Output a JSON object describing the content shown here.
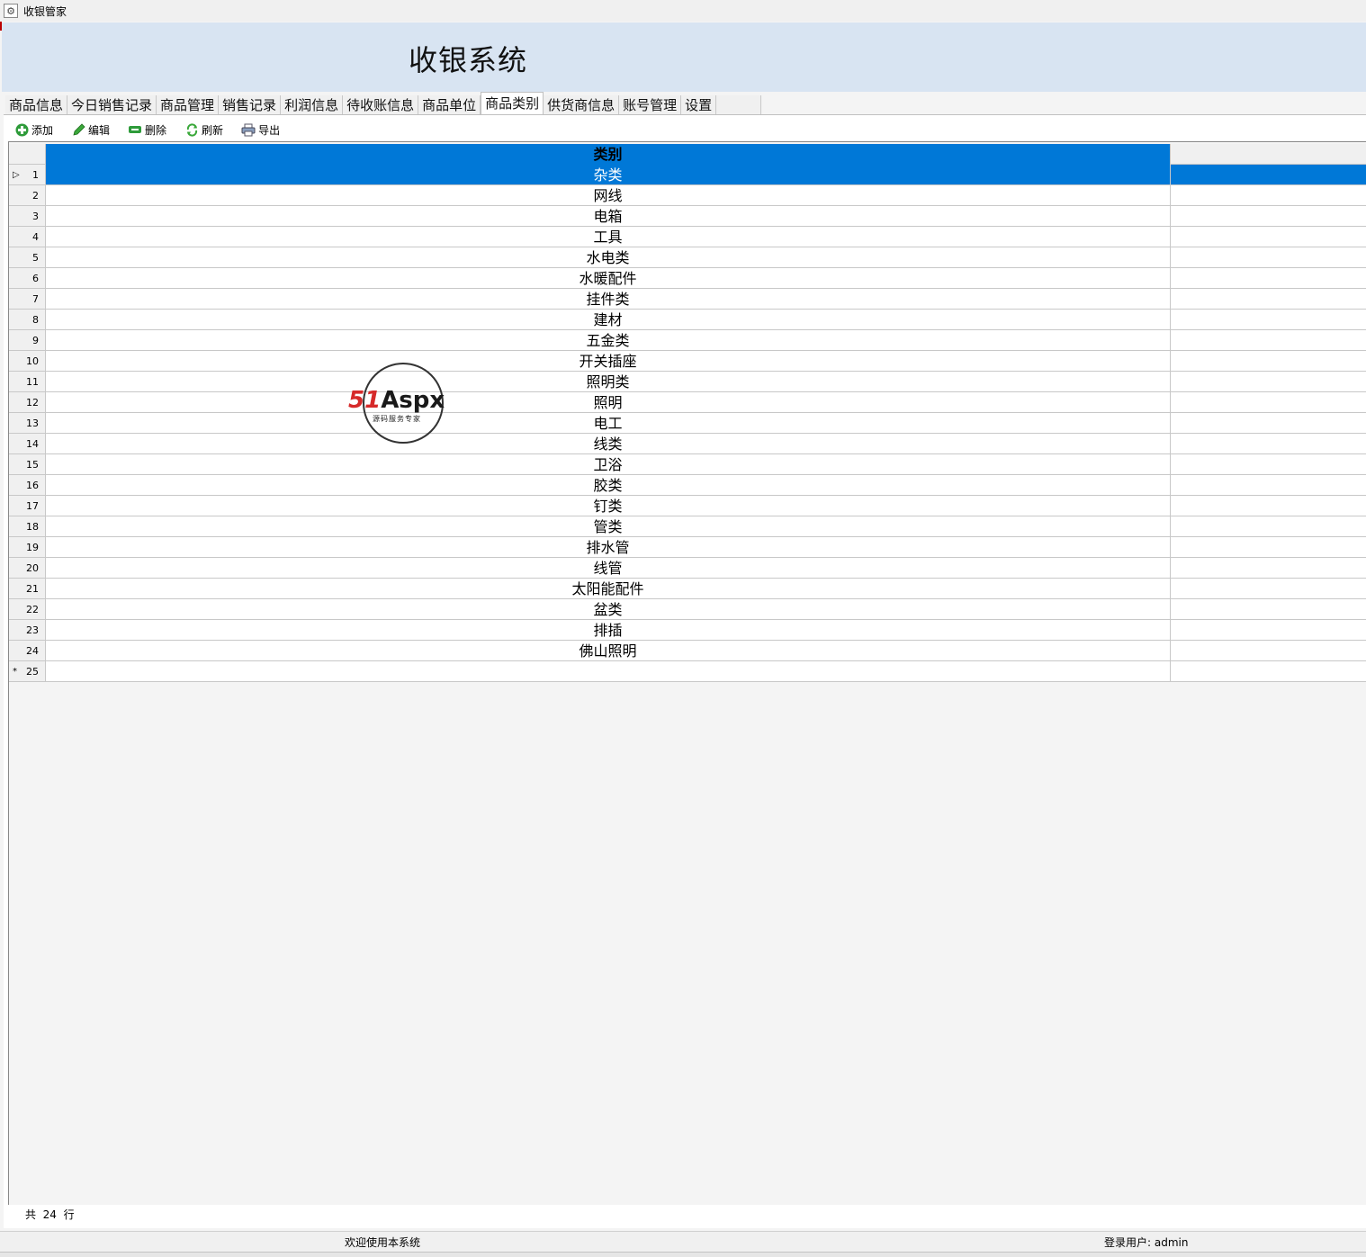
{
  "window": {
    "title": "收银管家"
  },
  "banner": {
    "title": "收银系统"
  },
  "tabs": [
    {
      "label": "商品信息"
    },
    {
      "label": "今日销售记录"
    },
    {
      "label": "商品管理"
    },
    {
      "label": "销售记录"
    },
    {
      "label": "利润信息"
    },
    {
      "label": "待收账信息"
    },
    {
      "label": "商品单位"
    },
    {
      "label": "商品类别"
    },
    {
      "label": "供货商信息"
    },
    {
      "label": "账号管理"
    },
    {
      "label": "设置"
    }
  ],
  "active_tab": "商品类别",
  "toolbar": {
    "add_label": "添加",
    "edit_label": "编辑",
    "delete_label": "删除",
    "refresh_label": "刷新",
    "export_label": "导出"
  },
  "grid": {
    "column_header": "类别",
    "selected_row": 1,
    "rows": [
      {
        "num": "1",
        "category": "杂类"
      },
      {
        "num": "2",
        "category": "网线"
      },
      {
        "num": "3",
        "category": "电箱"
      },
      {
        "num": "4",
        "category": "工具"
      },
      {
        "num": "5",
        "category": "水电类"
      },
      {
        "num": "6",
        "category": "水暖配件"
      },
      {
        "num": "7",
        "category": "挂件类"
      },
      {
        "num": "8",
        "category": "建材"
      },
      {
        "num": "9",
        "category": "五金类"
      },
      {
        "num": "10",
        "category": "开关插座"
      },
      {
        "num": "11",
        "category": "照明类"
      },
      {
        "num": "12",
        "category": "照明"
      },
      {
        "num": "13",
        "category": "电工"
      },
      {
        "num": "14",
        "category": "线类"
      },
      {
        "num": "15",
        "category": "卫浴"
      },
      {
        "num": "16",
        "category": "胶类"
      },
      {
        "num": "17",
        "category": "钉类"
      },
      {
        "num": "18",
        "category": "管类"
      },
      {
        "num": "19",
        "category": "排水管"
      },
      {
        "num": "20",
        "category": "线管"
      },
      {
        "num": "21",
        "category": "太阳能配件"
      },
      {
        "num": "22",
        "category": "盆类"
      },
      {
        "num": "23",
        "category": "排插"
      },
      {
        "num": "24",
        "category": "佛山照明"
      }
    ],
    "new_row_num": "25"
  },
  "count": {
    "prefix": "共",
    "value": "24",
    "suffix": "行"
  },
  "watermark": {
    "brand_red": "51",
    "brand_dark": "Aspx",
    "tagline": "源码服务专家"
  },
  "status": {
    "welcome": "欢迎使用本系统",
    "user": "登录用户: admin"
  },
  "colors": {
    "selection": "#0078d7",
    "banner": "#d8e4f2"
  }
}
